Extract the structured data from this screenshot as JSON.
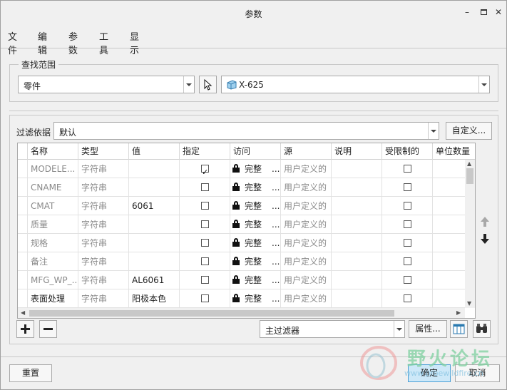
{
  "window": {
    "title": "参数"
  },
  "menu": [
    "文件",
    "编辑",
    "参数",
    "工具",
    "显示"
  ],
  "scope": {
    "legend": "查找范围",
    "type_value": "零件",
    "object_value": "X-625"
  },
  "filter": {
    "label": "过滤依据",
    "value": "默认",
    "customize_button": "自定义..."
  },
  "table": {
    "columns": [
      "名称",
      "类型",
      "值",
      "指定",
      "访问",
      "源",
      "说明",
      "受限制的",
      "单位数量"
    ],
    "rows": [
      {
        "name": "MODELE...",
        "type": "字符串",
        "value": "",
        "designated": true,
        "access": "完整",
        "access_more": "...",
        "source": "用户定义的",
        "restricted": false,
        "name_gray": true
      },
      {
        "name": "CNAME",
        "type": "字符串",
        "value": "",
        "designated": false,
        "access": "完整",
        "access_more": "...",
        "source": "用户定义的",
        "restricted": false,
        "name_gray": true
      },
      {
        "name": "CMAT",
        "type": "字符串",
        "value": "6061",
        "designated": false,
        "access": "完整",
        "access_more": "...",
        "source": "用户定义的",
        "restricted": false,
        "name_gray": true
      },
      {
        "name": "质量",
        "type": "字符串",
        "value": "",
        "designated": false,
        "access": "完整",
        "access_more": "...",
        "source": "用户定义的",
        "restricted": false,
        "name_gray": true
      },
      {
        "name": "规格",
        "type": "字符串",
        "value": "",
        "designated": false,
        "access": "完整",
        "access_more": "...",
        "source": "用户定义的",
        "restricted": false,
        "name_gray": true
      },
      {
        "name": "备注",
        "type": "字符串",
        "value": "",
        "designated": false,
        "access": "完整",
        "access_more": "...",
        "source": "用户定义的",
        "restricted": false,
        "name_gray": true
      },
      {
        "name": "MFG_WP_...",
        "type": "字符串",
        "value": "AL6061",
        "designated": false,
        "access": "完整",
        "access_more": "...",
        "source": "用户定义的",
        "restricted": false,
        "name_gray": true
      },
      {
        "name": "表面处理",
        "type": "字符串",
        "value": "阳极本色",
        "designated": false,
        "access": "完整",
        "access_more": "...",
        "source": "用户定义的",
        "restricted": false,
        "name_gray": false
      }
    ]
  },
  "bottom": {
    "main_filter": "主过滤器",
    "properties_button": "属性...",
    "reset_button": "重置",
    "ok_button": "确定",
    "cancel_button": "取消"
  },
  "watermark": {
    "text": "野火论坛",
    "url": "www.proewildfire.cn"
  },
  "colors": {
    "accent": "#2a7ab0",
    "ok_button_bg": "#cde8f8"
  }
}
